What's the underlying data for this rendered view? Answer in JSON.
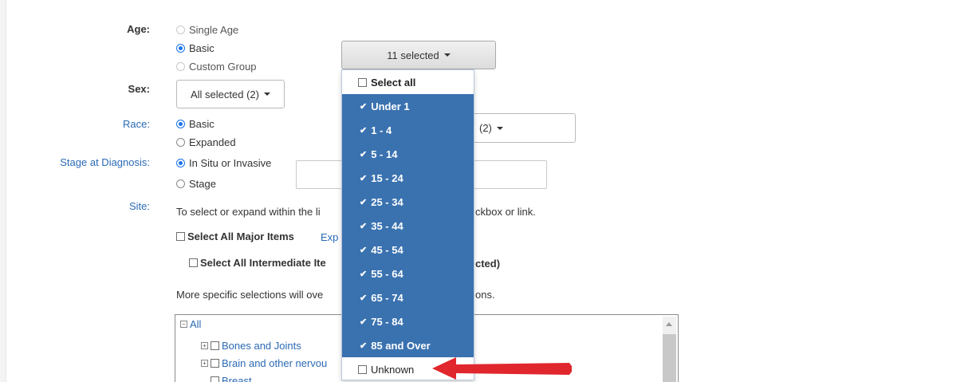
{
  "labels": {
    "age": "Age:",
    "sex": "Sex:",
    "race": "Race:",
    "stage": "Stage at Diagnosis:",
    "site": "Site:"
  },
  "age": {
    "options": [
      "Single Age",
      "Basic",
      "Custom Group"
    ],
    "dropdown_label": "11 selected"
  },
  "sex": {
    "dropdown_label": "All selected (2)"
  },
  "race": {
    "options": [
      "Basic",
      "Expanded"
    ],
    "dropdown_fragment": "(2)"
  },
  "stage": {
    "options": [
      "In Situ or Invasive",
      "Stage"
    ]
  },
  "site": {
    "instruction_left": "To select or expand within the li",
    "instruction_right": "ckbox or link.",
    "select_all_major": "Select All Major Items",
    "expand_fragment": "Exp",
    "select_all_intermediate": "Select All Intermediate Ite",
    "intermediate_fragment": "cted)",
    "more_left": "More specific selections will ove",
    "more_right": "ons.",
    "tree": {
      "root": "All",
      "items": [
        "Bones and Joints",
        "Brain and other nervou",
        "Breast"
      ]
    }
  },
  "age_menu": {
    "select_all": "Select all",
    "items": [
      {
        "label": "Under 1",
        "checked": true
      },
      {
        "label": "1 - 4",
        "checked": true
      },
      {
        "label": "5 - 14",
        "checked": true
      },
      {
        "label": "15 - 24",
        "checked": true
      },
      {
        "label": "25 - 34",
        "checked": true
      },
      {
        "label": "35 - 44",
        "checked": true
      },
      {
        "label": "45 - 54",
        "checked": true
      },
      {
        "label": "55 - 64",
        "checked": true
      },
      {
        "label": "65 - 74",
        "checked": true
      },
      {
        "label": "75 - 84",
        "checked": true
      },
      {
        "label": "85 and Over",
        "checked": true
      }
    ],
    "unknown": "Unknown"
  },
  "colors": {
    "accent": "#3a72b0",
    "link": "#2b6ab5",
    "arrow": "#e0272d"
  },
  "icons": [
    "checkmark-icon",
    "caret-down-icon",
    "tree-expand-icon",
    "scroll-up-icon",
    "red-arrow-icon"
  ]
}
